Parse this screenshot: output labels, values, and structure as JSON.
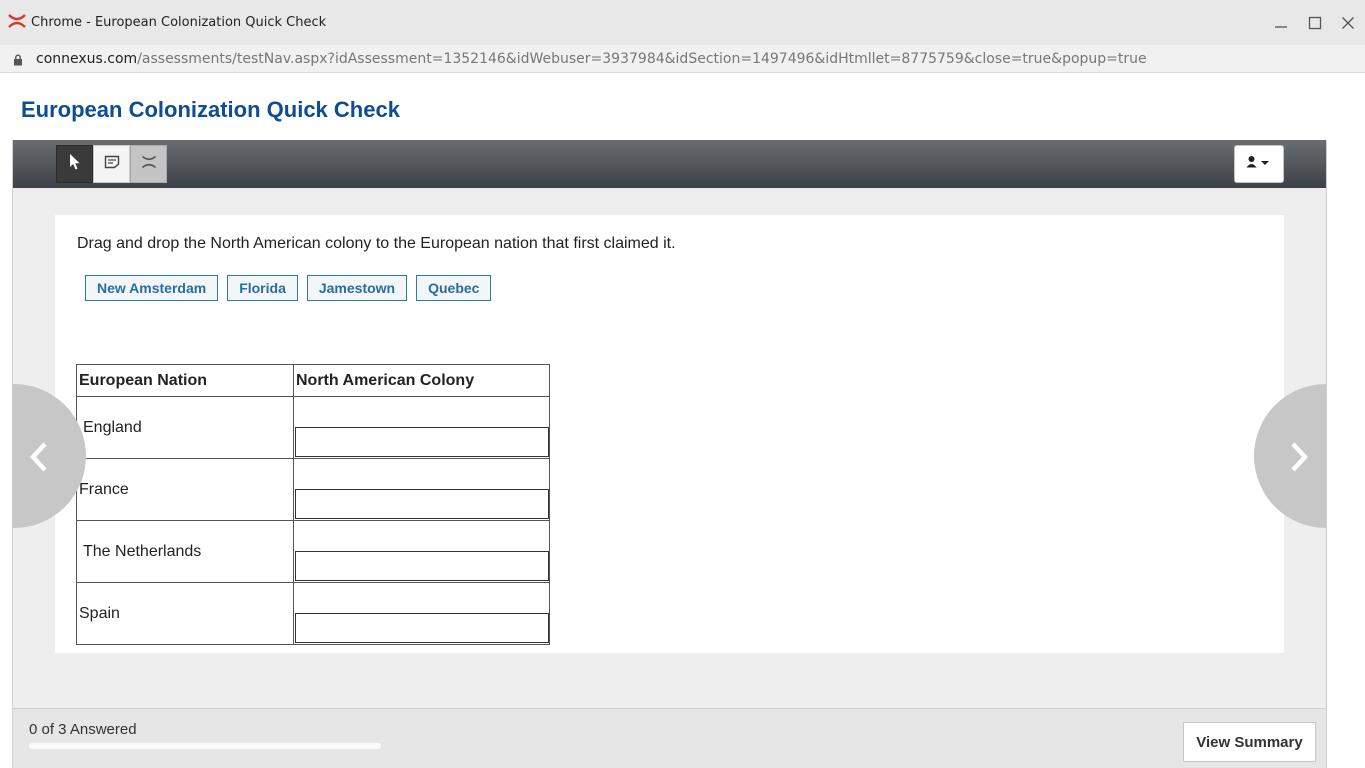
{
  "window": {
    "title": "Chrome - European Colonization Quick Check"
  },
  "address_bar": {
    "host": "connexus.com",
    "path": "/assessments/testNav.aspx?idAssessment=1352146&idWebuser=3937984&idSection=1497496&idHtmllet=8775759&close=true&popup=true"
  },
  "page": {
    "title": "European Colonization Quick Check"
  },
  "toolbar": {
    "tools": [
      "pointer-icon",
      "note-icon",
      "eliminate-icon"
    ],
    "user_menu_icon": "user-icon"
  },
  "question": {
    "prompt": "Drag and drop the North American colony to the European nation that first claimed it.",
    "choices": [
      "New Amsterdam",
      "Florida",
      "Jamestown",
      "Quebec"
    ],
    "table": {
      "headers": [
        "European Nation",
        "North American Colony"
      ],
      "rows": [
        {
          "nation": "England",
          "answer": ""
        },
        {
          "nation": "France",
          "answer": ""
        },
        {
          "nation": "The Netherlands",
          "answer": ""
        },
        {
          "nation": "Spain",
          "answer": ""
        }
      ]
    }
  },
  "footer": {
    "progress_text": "0 of 3 Answered",
    "answered": 0,
    "total": 3,
    "summary_label": "View Summary"
  },
  "colors": {
    "brand_title": "#0f4d92",
    "chip_border": "#2f79a7",
    "chip_text": "#2a6d9c"
  }
}
